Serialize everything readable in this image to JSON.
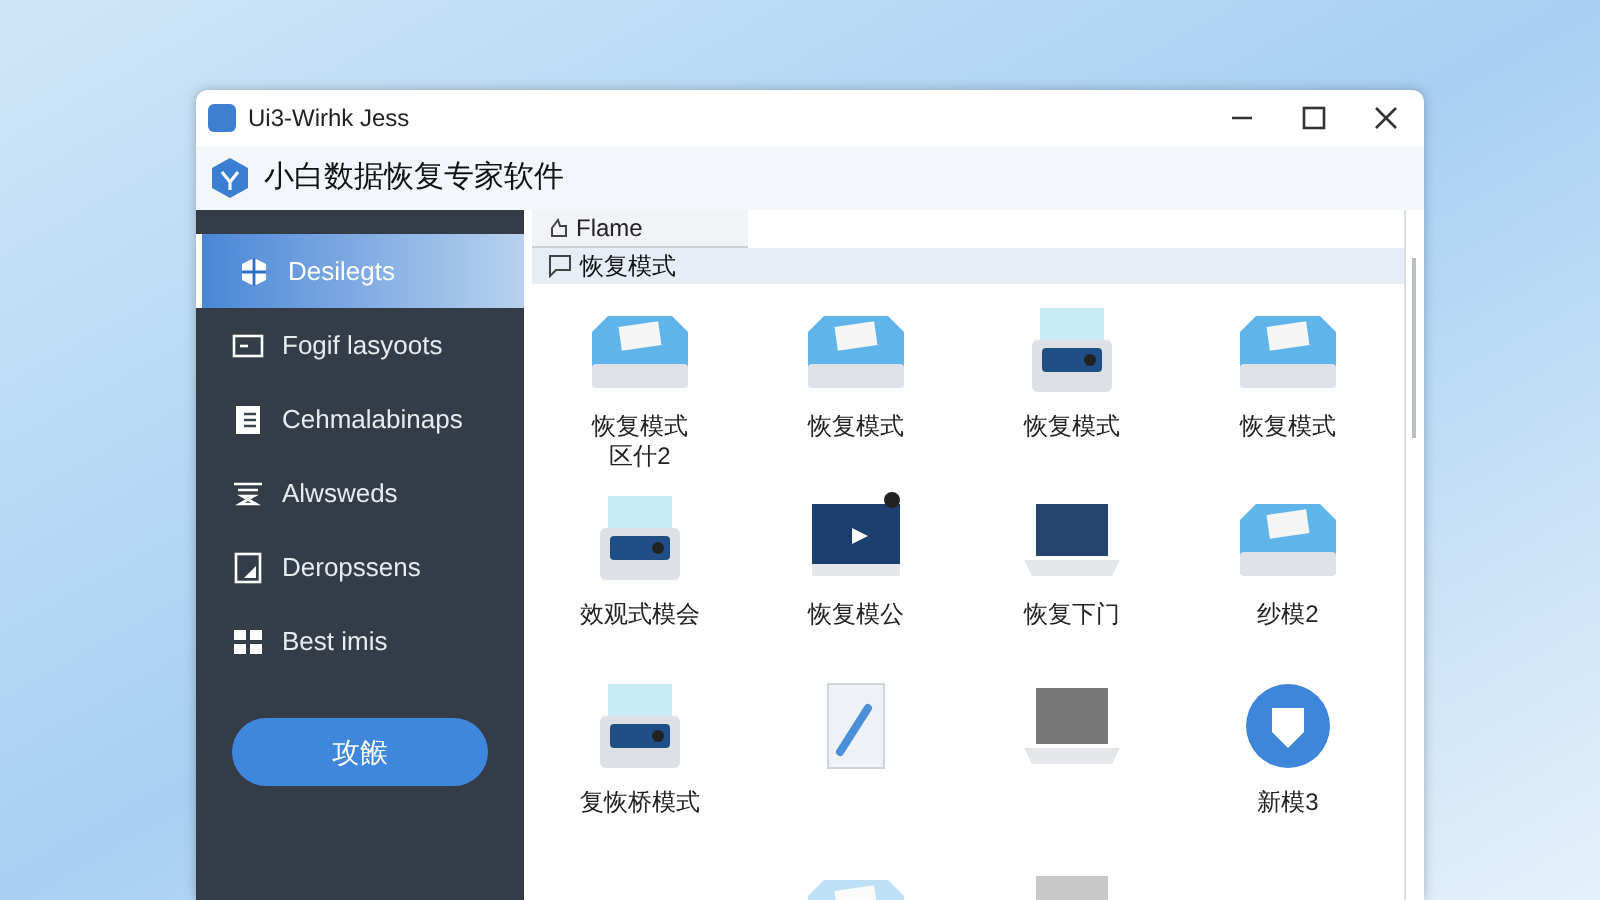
{
  "window": {
    "title": "Ui3-Wirhk Jess"
  },
  "app": {
    "name": "小白数据恢复专家软件"
  },
  "sidebar": {
    "items": [
      {
        "label": "Desilegts",
        "kind": "cube",
        "selected": true
      },
      {
        "label": "Fogif lasyoots",
        "kind": "monitor",
        "selected": false
      },
      {
        "label": "Cehmalabinaps",
        "kind": "book",
        "selected": false
      },
      {
        "label": "Alwsweds",
        "kind": "stand",
        "selected": false
      },
      {
        "label": "Deropssens",
        "kind": "document",
        "selected": false
      },
      {
        "label": "Best imis",
        "kind": "grid",
        "selected": false
      }
    ],
    "button": "攻餱"
  },
  "list_header": {
    "column": "Flame"
  },
  "path_row": {
    "label": "恢复模式"
  },
  "grid": {
    "items": [
      {
        "kind": "drive",
        "lines": [
          "恢复模式",
          "区什2"
        ]
      },
      {
        "kind": "drive",
        "lines": [
          "恢复模式"
        ]
      },
      {
        "kind": "scanner",
        "lines": [
          "恢复模式"
        ]
      },
      {
        "kind": "drive",
        "lines": [
          "恢复模式"
        ]
      },
      {
        "kind": "scanner",
        "lines": [
          "效观式模会"
        ]
      },
      {
        "kind": "monitor",
        "lines": [
          "恢复模公"
        ]
      },
      {
        "kind": "laptop",
        "lines": [
          "恢复下门"
        ]
      },
      {
        "kind": "drive",
        "lines": [
          "纱模2"
        ]
      },
      {
        "kind": "scanner",
        "lines": [
          "复恢桥模式"
        ]
      },
      {
        "kind": "document"
      },
      {
        "kind": "laptop_s"
      },
      {
        "kind": "shield",
        "lines": [
          "新模3"
        ]
      },
      {
        "kind": "blank"
      },
      {
        "kind": "drive"
      },
      {
        "kind": "laptop_s"
      }
    ]
  }
}
